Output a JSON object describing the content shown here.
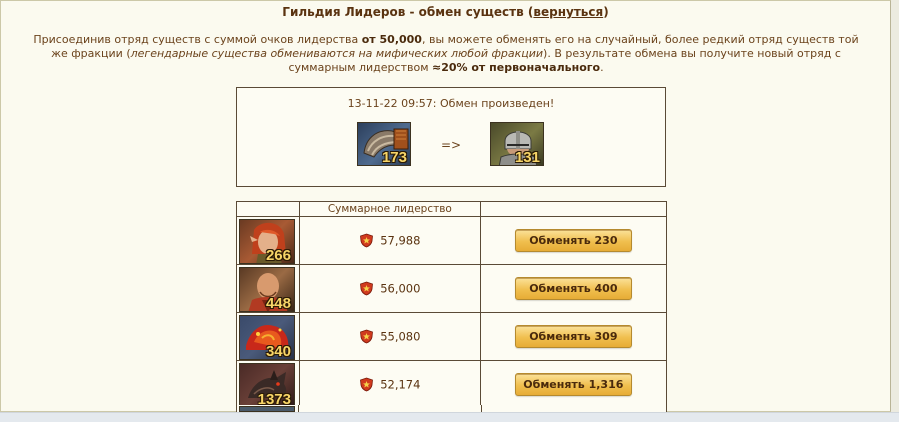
{
  "header": {
    "title": "Гильдия Лидеров - обмен существ",
    "back_link": "вернуться"
  },
  "description": {
    "part1": "Присоединив отряд существ с суммой очков лидерства ",
    "bold1": "от 50,000",
    "part2": ", вы можете обменять его на случайный, более редкий отряд существ той же фракции (",
    "italic": "легендарные существа обмениваются на мифических любой фракции",
    "part3": "). В результате обмена вы получите новый отряд с суммарным лидерством ",
    "bold2": "≈20% от первоначального",
    "part4": "."
  },
  "exchange_result": {
    "message": "13-11-22 09:57: Обмен произведен!",
    "arrow": "=>",
    "from_unit": {
      "count": "173",
      "icon": "armored-arm-unit"
    },
    "to_unit": {
      "count": "131",
      "icon": "helmeted-warrior-unit"
    }
  },
  "table": {
    "header_leadership": "Суммарное лидерство",
    "rows": [
      {
        "unit_count": "266",
        "icon": "red-haired-elf-unit",
        "leadership": "57,988",
        "button": "Обменять 230"
      },
      {
        "unit_count": "448",
        "icon": "bald-monk-unit",
        "leadership": "56,000",
        "button": "Обменять 400"
      },
      {
        "unit_count": "340",
        "icon": "fire-creature-unit",
        "leadership": "55,080",
        "button": "Обменять 309"
      },
      {
        "unit_count": "1373",
        "icon": "dark-hound-unit",
        "leadership": "52,174",
        "button": "Обменять 1,316"
      }
    ]
  },
  "colors": {
    "background": "#fbfaef",
    "text": "#5a3310",
    "border": "#5a4a36",
    "button": "#f0bf4e",
    "count": "#f7d568"
  }
}
